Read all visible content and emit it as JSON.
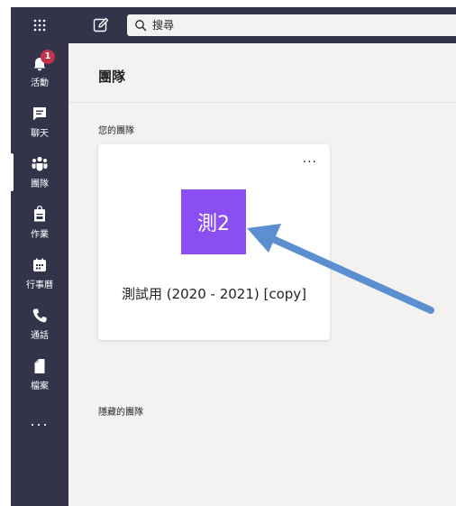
{
  "search": {
    "placeholder": "搜尋"
  },
  "rail": {
    "items": [
      {
        "label": "活動",
        "badge": "1"
      },
      {
        "label": "聊天"
      },
      {
        "label": "團隊"
      },
      {
        "label": "作業"
      },
      {
        "label": "行事曆"
      },
      {
        "label": "通話"
      },
      {
        "label": "檔案"
      }
    ],
    "more": "..."
  },
  "main": {
    "title": "團隊",
    "your_teams_label": "您的團隊",
    "hidden_teams_label": "隱藏的團隊",
    "team_card": {
      "more": "...",
      "avatar_text": "測2",
      "name": "測試用 (2020 - 2021) [copy]",
      "avatar_color": "#8b4ef2"
    }
  },
  "colors": {
    "rail_bg": "#33344a",
    "badge": "#c4314b",
    "annotation_arrow": "#5b8fcf"
  }
}
